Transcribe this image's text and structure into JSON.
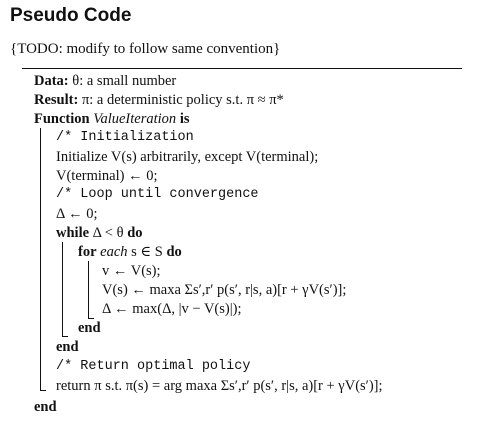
{
  "header": {
    "title": "Pseudo Code",
    "subtitle": "{TODO: modify to follow same convention}"
  },
  "algorithm": {
    "data_kw": "Data:",
    "data_text": "θ: a small number",
    "result_kw": "Result:",
    "result_text": "π: a deterministic policy s.t. π ≈ π*",
    "function_kw": "Function",
    "function_name": "ValueIteration",
    "is_kw": "is",
    "comment_init": "/* Initialization",
    "init_line": "Initialize V(s) arbitrarily, except V(terminal);",
    "terminal_line": "V(terminal) ← 0;",
    "comment_loop": "/* Loop until convergence",
    "delta_init": "Δ ← 0;",
    "while_kw": "while",
    "while_cond": "Δ < θ",
    "do_kw": "do",
    "for_kw": "for",
    "for_each": "each",
    "for_cond": "s ∈ S",
    "assign_v": "v ← V(s);",
    "update_v": "V(s) ← maxa Σs′,r′ p(s′, r|s, a)[r + γV(s′)];",
    "update_delta": "Δ ← max(Δ, |v − V(s)|);",
    "end_kw": "end",
    "comment_return": "/* Return optimal policy",
    "return_line": "return π s.t. π(s) = arg maxa Σs′,r′ p(s′, r|s, a)[r + γV(s′)];"
  }
}
